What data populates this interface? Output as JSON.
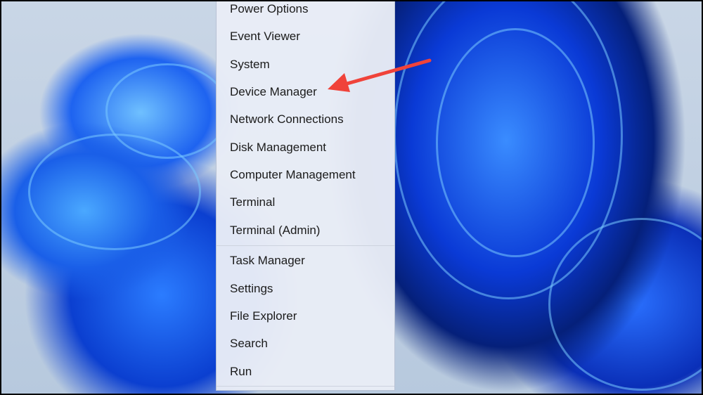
{
  "menu": {
    "items": [
      {
        "label": "Power Options"
      },
      {
        "label": "Event Viewer"
      },
      {
        "label": "System"
      },
      {
        "label": "Device Manager"
      },
      {
        "label": "Network Connections"
      },
      {
        "label": "Disk Management"
      },
      {
        "label": "Computer Management"
      },
      {
        "label": "Terminal"
      },
      {
        "label": "Terminal (Admin)"
      },
      {
        "label": "Task Manager"
      },
      {
        "label": "Settings"
      },
      {
        "label": "File Explorer"
      },
      {
        "label": "Search"
      },
      {
        "label": "Run"
      }
    ]
  },
  "annotation": {
    "arrow_color": "#f0433a",
    "points_to": "Device Manager"
  }
}
